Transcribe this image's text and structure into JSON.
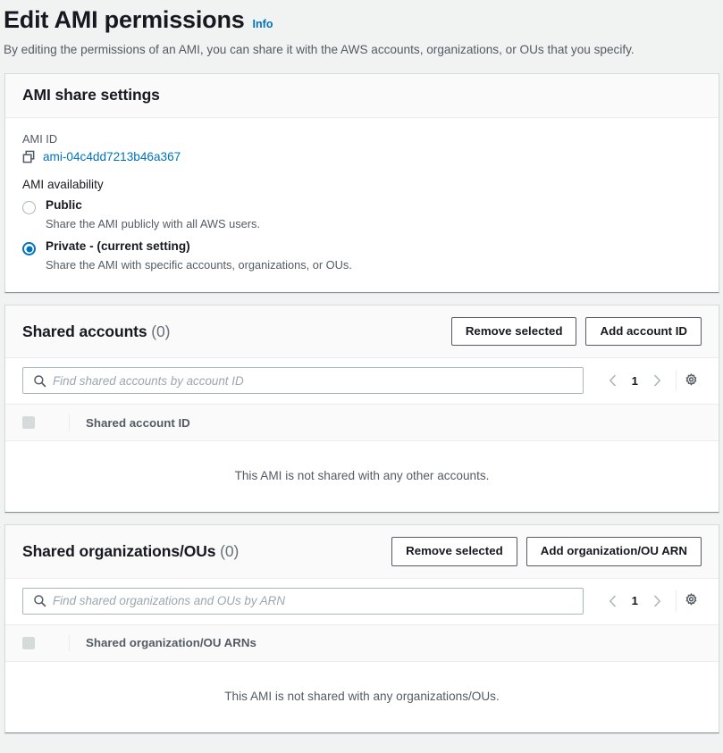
{
  "header": {
    "title": "Edit AMI permissions",
    "info_label": "Info",
    "description": "By editing the permissions of an AMI, you can share it with the AWS accounts, organizations, or OUs that you specify."
  },
  "share_settings": {
    "panel_title": "AMI share settings",
    "ami_id_label": "AMI ID",
    "ami_id_value": "ami-04c4dd7213b46a367",
    "copy_icon": "copy-icon",
    "availability_label": "AMI availability",
    "options": [
      {
        "label": "Public",
        "description": "Share the AMI publicly with all AWS users.",
        "selected": false
      },
      {
        "label": "Private - (current setting)",
        "description": "Share the AMI with specific accounts, organizations, or OUs.",
        "selected": true
      }
    ]
  },
  "shared_accounts": {
    "panel_title": "Shared accounts",
    "count": "(0)",
    "remove_label": "Remove selected",
    "add_label": "Add account ID",
    "search_placeholder": "Find shared accounts by account ID",
    "search_value": "",
    "search_icon": "search-icon",
    "page_number": "1",
    "prev_icon": "chevron-left-icon",
    "next_icon": "chevron-right-icon",
    "settings_icon": "gear-icon",
    "column_header": "Shared account ID",
    "empty_message": "This AMI is not shared with any other accounts."
  },
  "shared_organizations": {
    "panel_title": "Shared organizations/OUs",
    "count": "(0)",
    "remove_label": "Remove selected",
    "add_label": "Add organization/OU ARN",
    "search_placeholder": "Find shared organizations and OUs by ARN",
    "search_value": "",
    "search_icon": "search-icon",
    "page_number": "1",
    "prev_icon": "chevron-left-icon",
    "next_icon": "chevron-right-icon",
    "settings_icon": "gear-icon",
    "column_header": "Shared organization/OU ARNs",
    "empty_message": "This AMI is not shared with any organizations/OUs."
  },
  "colors": {
    "link": "#0073bb",
    "page_bg": "#f1f3f3",
    "panel_bg": "#ffffff",
    "panel_header_bg": "#fafafa",
    "text": "#16191f",
    "secondary_text": "#545b64",
    "border": "#d5dbdb"
  }
}
